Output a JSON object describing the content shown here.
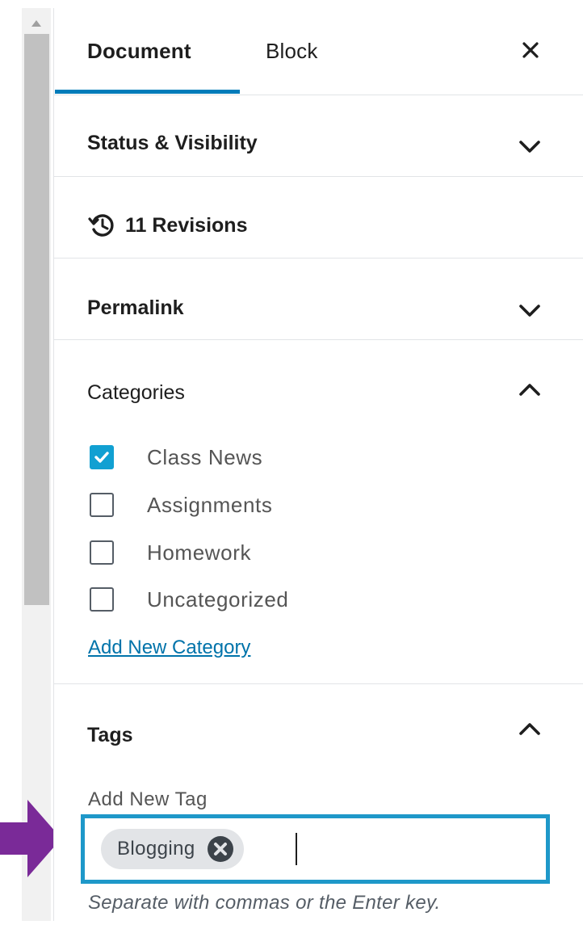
{
  "tabs": {
    "document": "Document",
    "block": "Block"
  },
  "colors": {
    "accent": "#007cba",
    "checkbox_checked": "#11a0d2",
    "tag_field_border": "#1e98c9",
    "pointer_arrow": "#7a2a98"
  },
  "icons": {
    "close": "close-icon",
    "chevron_down": "chevron-down-icon",
    "chevron_up": "chevron-up-icon",
    "history": "history-icon",
    "checkmark": "checkmark-icon",
    "remove_tag": "remove-tag-icon",
    "pointer": "arrow-right-icon"
  },
  "sections": {
    "status": {
      "title": "Status & Visibility",
      "expanded": false
    },
    "revisions": {
      "label": "11 Revisions"
    },
    "permalink": {
      "title": "Permalink",
      "expanded": false
    },
    "categories": {
      "title": "Categories",
      "expanded": true,
      "items": [
        {
          "label": "Class News",
          "checked": true
        },
        {
          "label": "Assignments",
          "checked": false
        },
        {
          "label": "Homework",
          "checked": false
        },
        {
          "label": "Uncategorized",
          "checked": false
        }
      ],
      "add_new_link": "Add New Category"
    },
    "tags": {
      "title": "Tags",
      "expanded": true,
      "field_label": "Add New Tag",
      "tokens": [
        "Blogging"
      ],
      "input_value": "",
      "help_text": "Separate with commas or the Enter key."
    }
  }
}
